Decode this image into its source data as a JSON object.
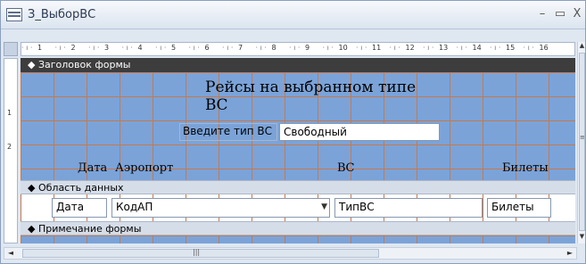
{
  "window": {
    "title": "З_ВыборВС",
    "minimize": "–",
    "maximize": "▭",
    "close": "X"
  },
  "ruler": {
    "h_ticks": [
      "1",
      "2",
      "3",
      "4",
      "5",
      "6",
      "7",
      "8",
      "9",
      "10",
      "11",
      "12",
      "13",
      "14",
      "15",
      "16"
    ],
    "v_ticks": [
      "1",
      "2"
    ]
  },
  "sections": {
    "form_header": "Заголовок формы",
    "detail": "Область данных",
    "form_footer": "Примечание формы"
  },
  "header_controls": {
    "title_label": "Рейсы на выбранном типе ВС",
    "prompt_label": "Введите тип ВС",
    "input_value": "Свободный",
    "col_date": "Дата",
    "col_airport": "Аэропорт",
    "col_aircraft": "ВС",
    "col_tickets": "Билеты"
  },
  "detail_controls": {
    "date_field": "Дата",
    "airport_combo": "КодАП",
    "aircraft_field": "ТипВС",
    "tickets_field": "Билеты"
  },
  "icons": {
    "section_marker": "◆",
    "combo_arrow": "▼",
    "scroll_up": "▲",
    "scroll_down": "▼",
    "scroll_left": "◄",
    "scroll_right": "►",
    "scroll_grip": "≡",
    "hscroll_grip": "|||"
  }
}
